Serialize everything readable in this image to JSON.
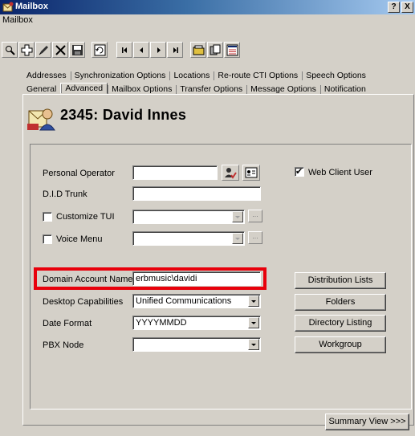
{
  "window": {
    "title": "Mailbox",
    "help_glyph": "?",
    "close_glyph": "X"
  },
  "menu": {
    "item": "Mailbox"
  },
  "toolbar": {
    "buttons": [
      "search-icon",
      "add-icon",
      "edit-icon",
      "delete-icon",
      "save-icon",
      "refresh-icon",
      "first-record-icon",
      "previous-record-icon",
      "next-record-icon",
      "last-record-icon",
      "folder-icon",
      "copy-icon",
      "list-view-icon"
    ]
  },
  "tabs": {
    "row_back": [
      "Addresses",
      "Synchronization Options",
      "Locations",
      "Re-route CTI Options",
      "Speech Options"
    ],
    "row_front": [
      "General",
      "Advanced",
      "Mailbox Options",
      "Transfer Options",
      "Message Options",
      "Notification"
    ],
    "active": "Advanced"
  },
  "header": {
    "title": "2345: David Innes"
  },
  "form": {
    "personal_operator": {
      "label": "Personal Operator",
      "value": ""
    },
    "did_trunk": {
      "label": "D.I.D Trunk",
      "value": ""
    },
    "customize_tui": {
      "label": "Customize TUI",
      "checked": false,
      "value": "",
      "ellipsis": "..."
    },
    "voice_menu": {
      "label": "Voice Menu",
      "checked": false,
      "value": "",
      "ellipsis": "..."
    },
    "web_client_user": {
      "label": "Web Client User",
      "checked": true
    },
    "domain_account_name": {
      "label": "Domain Account Name",
      "value": "erbmusic\\davidi"
    },
    "desktop_capabilities": {
      "label": "Desktop Capabilities",
      "value": "Unified Communications"
    },
    "date_format": {
      "label": "Date Format",
      "value": "YYYYMMDD"
    },
    "pbx_node": {
      "label": "PBX Node",
      "value": ""
    }
  },
  "buttons": {
    "distribution_lists": "Distribution Lists",
    "folders": "Folders",
    "directory_listing": "Directory Listing",
    "workgroup": "Workgroup",
    "summary_view": "Summary View >>>"
  },
  "colors": {
    "highlight": "#e8000b",
    "titlebar": "#0a246a",
    "face": "#d4d0c8"
  }
}
